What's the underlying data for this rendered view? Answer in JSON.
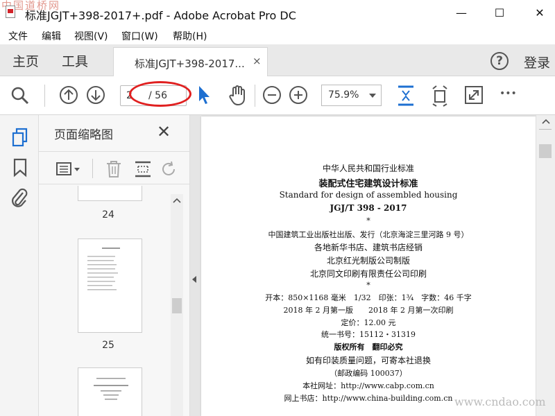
{
  "window": {
    "title": "标准JGJT+398-2017+.pdf - Adobe Acrobat Pro DC",
    "watermark_top": "中国道桥网",
    "minimize": "—",
    "maximize": "☐",
    "close": "✕"
  },
  "menu": [
    "文件",
    "编辑",
    "视图(V)",
    "窗口(W)",
    "帮助(H)"
  ],
  "tabs": {
    "home": "主页",
    "tools": "工具",
    "doc": "标准JGJT+398-2017...",
    "doc_close": "×"
  },
  "account": {
    "help": "?",
    "login": "登录"
  },
  "toolbar": {
    "current_page": "2",
    "total_pages": "/ 56",
    "zoom": "75.9%",
    "more": "•••"
  },
  "panel": {
    "title": "页面缩略图",
    "close": "✕",
    "thumbnails": [
      {
        "label": "24"
      },
      {
        "label": "25"
      }
    ]
  },
  "document": {
    "lines": [
      "中华人民共和国行业标准",
      "装配式住宅建筑设计标准",
      "Standard for design of assembled housing",
      "JGJ/T 398 - 2017",
      "*",
      "中国建筑工业出版社出版、发行（北京海淀三里河路 9 号）",
      "各地新华书店、建筑书店经销",
      "北京红光制版公司制版",
      "北京同文印刷有限责任公司印刷",
      "*",
      "开本：850×1168 毫米　1/32　印张：1¾　字数：46 千字",
      "2018 年 2 月第一版　　2018 年 2 月第一次印刷",
      "定价：12.00 元",
      "统一书号：15112・31319",
      "版权所有　翻印必究",
      "如有印装质量问题，可寄本社退换",
      "（邮政编码 100037）",
      "本社网址：http://www.cabp.com.cn",
      "网上书店：http://www.china-building.com.cn"
    ]
  },
  "watermark_bottom": "www.cndao.com"
}
